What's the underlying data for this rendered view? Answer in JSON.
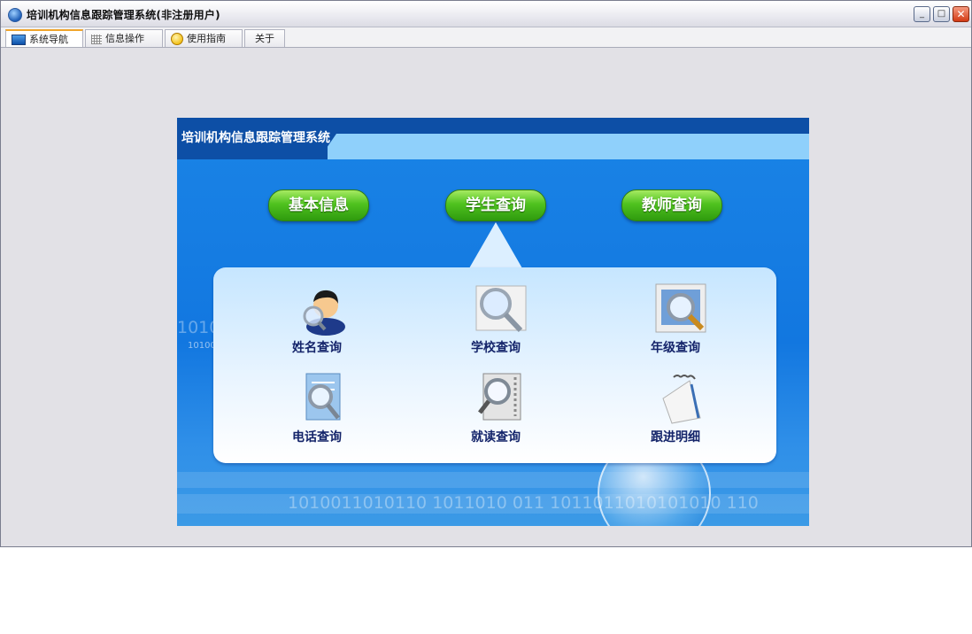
{
  "window": {
    "title": "培训机构信息跟踪管理系统(非注册用户)",
    "controls": {
      "minimize": "_",
      "maximize": "□",
      "close": "✕"
    }
  },
  "tabs": [
    {
      "label": "系统导航",
      "icon": "monitor-icon",
      "active": true
    },
    {
      "label": "信息操作",
      "icon": "grid-icon",
      "active": false
    },
    {
      "label": "使用指南",
      "icon": "help-icon",
      "active": false
    },
    {
      "label": "关于",
      "icon": "",
      "active": false
    }
  ],
  "panel": {
    "title": "培训机构信息跟踪管理系统",
    "buttons": [
      "基本信息",
      "学生查询",
      "教师查询"
    ],
    "menu_items": [
      {
        "label": "姓名查询",
        "icon": "person-search-icon"
      },
      {
        "label": "学校查询",
        "icon": "magnifier-icon"
      },
      {
        "label": "年级查询",
        "icon": "picture-search-icon"
      },
      {
        "label": "电话查询",
        "icon": "document-search-icon"
      },
      {
        "label": "就读查询",
        "icon": "scroll-search-icon"
      },
      {
        "label": "跟进明细",
        "icon": "notepad-icon"
      }
    ],
    "background_text": {
      "binary_main": "1010011010110   1011010  011   1011011010101010   110",
      "binary_left": "1010",
      "binary_left_small": "10100"
    },
    "colors": {
      "header": "#0d4fa6",
      "button_green": "#4fc21f",
      "label": "#14246a"
    }
  }
}
